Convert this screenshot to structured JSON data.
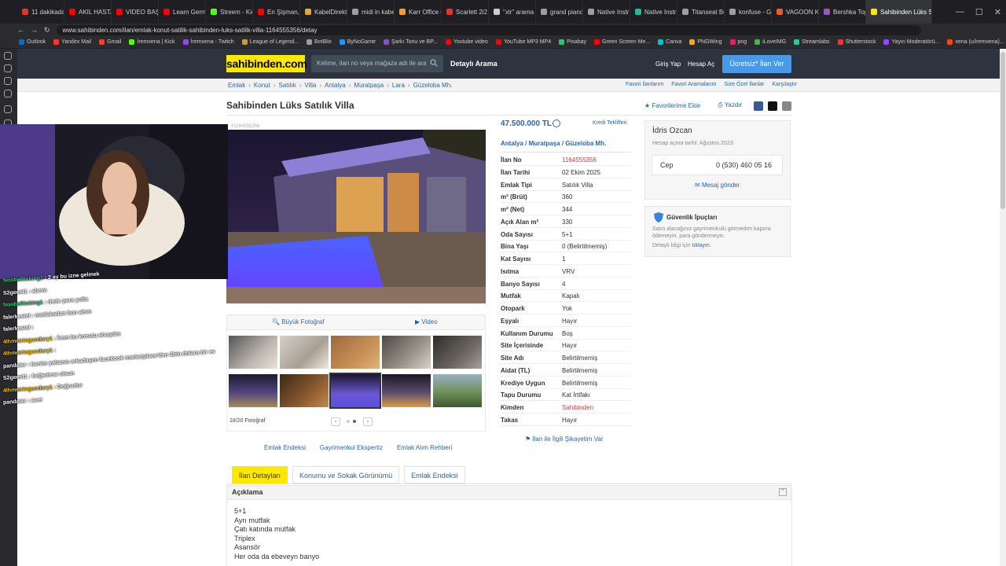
{
  "browser": {
    "tabs": [
      {
        "label": "11 dakikada",
        "color": "#e5322d"
      },
      {
        "label": "AKIL HASTA",
        "color": "#ff0000"
      },
      {
        "label": "VIDEO BAŞI",
        "color": "#ff0000"
      },
      {
        "label": "Learn Germ",
        "color": "#ff0000"
      },
      {
        "label": "Streem - Kic",
        "color": "#53fc18"
      },
      {
        "label": "En Şişman,",
        "color": "#ff0000"
      },
      {
        "label": "KabelDirekt",
        "color": "#e8a33c"
      },
      {
        "label": "midi in kabe",
        "color": "#9e9e9e"
      },
      {
        "label": "Karr Office C",
        "color": "#f0a030"
      },
      {
        "label": "Scarlett 2i2",
        "color": "#e5322d"
      },
      {
        "label": "\"xlr\" arama ",
        "color": "#cccccc"
      },
      {
        "label": "grand piano",
        "color": "#9e9e9e"
      },
      {
        "label": "Native Instru",
        "color": "#9e9e9e"
      },
      {
        "label": "Native Instru",
        "color": "#1abc9c"
      },
      {
        "label": "Titanseat Be",
        "color": "#9e9e9e"
      },
      {
        "label": "konfuse - G",
        "color": "#9e9e9e"
      },
      {
        "label": "VAGOON Ka",
        "color": "#e85a2a"
      },
      {
        "label": "Bershka Top",
        "color": "#9b59b6"
      },
      {
        "label": "Sahibinden Lüks Satılık",
        "color": "#ffe800"
      }
    ],
    "url": "www.sahibinden.com/ilan/emlak-konut-satilik-sahibinden-luks-satilik-villa-1164555356/detay",
    "bookmarks": [
      {
        "label": "Outlook",
        "color": "#0f6cbd"
      },
      {
        "label": "Yandex Mail",
        "color": "#ff3333"
      },
      {
        "label": "Gmail",
        "color": "#ea4335"
      },
      {
        "label": "İremxena | Kick",
        "color": "#53fc18"
      },
      {
        "label": "İremxena - Twitch",
        "color": "#9146ff"
      },
      {
        "label": "League of Legend...",
        "color": "#c89b3c"
      },
      {
        "label": "BotBlix",
        "color": "#9e9e9e"
      },
      {
        "label": "ByNoGame",
        "color": "#2196f3"
      },
      {
        "label": "Şarkı Tonu ve BP...",
        "color": "#7e57c2"
      },
      {
        "label": "Youtube video",
        "color": "#ff0000"
      },
      {
        "label": "YouTube MP3 MP4",
        "color": "#ff0000"
      },
      {
        "label": "Pixabay",
        "color": "#2ec66d"
      },
      {
        "label": "Green Screen Me...",
        "color": "#ff0000"
      },
      {
        "label": "Canva",
        "color": "#00c4cc"
      },
      {
        "label": "PNGWing",
        "color": "#f5a623"
      },
      {
        "label": "png",
        "color": "#e91e63"
      },
      {
        "label": "iLoveIMG",
        "color": "#4caf50"
      },
      {
        "label": "Streamlabs",
        "color": "#31c3a2"
      },
      {
        "label": "Shutterstock",
        "color": "#e53935"
      },
      {
        "label": "Yayın Moderatörü...",
        "color": "#9146ff"
      },
      {
        "label": "xena (u/iremxena)...",
        "color": "#ff4500"
      }
    ]
  },
  "header": {
    "logo": "sahibinden.com",
    "search_placeholder": "Kelime, ilan no veya mağaza adı ile ara",
    "advanced_search": "Detaylı Arama",
    "login": "Giriş Yap",
    "register": "Hesap Aç",
    "post_ad": "Ücretsiz* İlan Ver"
  },
  "breadcrumb": [
    "Emlak",
    "Konut",
    "Satılık",
    "Villa",
    "Antalya",
    "Muratpaşa",
    "Lara",
    "Güzeloba Mh."
  ],
  "right_links": [
    "Favori İlanlarım",
    "Favori Aramalarım",
    "Size Özel İlanlar",
    "Karşılaştır"
  ],
  "listing": {
    "title": "Sahibinden Lüks Satılık Villa",
    "add_favorite": "Favorilerime Ekle",
    "print": "Yazdır",
    "image_id": "#1164555356",
    "big_photo": "Büyük Fotoğraf",
    "video": "Video",
    "photo_counter": "18/20 Fotoğraf",
    "price": "47.500.000 TL",
    "credit_offers": "Kredi Teklifleri",
    "location": {
      "city": "Antalya",
      "district": "Muratpaşa",
      "neighborhood": "Güzeloba Mh."
    },
    "specs": [
      {
        "key": "İlan No",
        "value": "1164555356",
        "red": true
      },
      {
        "key": "İlan Tarihi",
        "value": "02 Ekim 2025"
      },
      {
        "key": "Emlak Tipi",
        "value": "Satılık Villa"
      },
      {
        "key": "m² (Brüt)",
        "value": "360"
      },
      {
        "key": "m² (Net)",
        "value": "344"
      },
      {
        "key": "Açık Alan m²",
        "value": "330"
      },
      {
        "key": "Oda Sayısı",
        "value": "5+1"
      },
      {
        "key": "Bina Yaşı",
        "value": "0 (Belirtilmemiş)"
      },
      {
        "key": "Kat Sayısı",
        "value": "1"
      },
      {
        "key": "Isıtma",
        "value": "VRV"
      },
      {
        "key": "Banyo Sayısı",
        "value": "4"
      },
      {
        "key": "Mutfak",
        "value": "Kapalı"
      },
      {
        "key": "Otopark",
        "value": "Yok"
      },
      {
        "key": "Eşyalı",
        "value": "Hayır"
      },
      {
        "key": "Kullanım Durumu",
        "value": "Boş"
      },
      {
        "key": "Site İçerisinde",
        "value": "Hayır"
      },
      {
        "key": "Site Adı",
        "value": "Belirtilmemiş"
      },
      {
        "key": "Aidat (TL)",
        "value": "Belirtilmemiş"
      },
      {
        "key": "Krediye Uygun",
        "value": "Belirtilmemiş"
      },
      {
        "key": "Tapu Durumu",
        "value": "Kat İrtifakı"
      },
      {
        "key": "Kimden",
        "value": "Sahibinden",
        "red": true
      },
      {
        "key": "Takas",
        "value": "Hayır"
      }
    ],
    "complaint": "İlan ile İlgili Şikayetim Var"
  },
  "seller": {
    "name": "İdris Ozcan",
    "since": "Hesap açma tarihi: Ağustos 2023",
    "phone_label": "Cep",
    "phone": "0 (530) 460 05 16",
    "message": "Mesaj gönder"
  },
  "security": {
    "title": "Güvenlik İpuçları",
    "text": "Satın alacağınız gayrimenkulü görmeden kapora ödemeyin, para göndermeyin.",
    "detail_prefix": "Detaylı bilgi için",
    "detail_link": "tıklayın."
  },
  "bottom_links": [
    "Emlak Endeksi",
    "Gayrimenkul Ekspertiz",
    "Emlak Alım Rehberi"
  ],
  "detail_tabs": [
    "İlan Detayları",
    "Konumu ve Sokak Görünümü",
    "Emlak Endeksi"
  ],
  "description": {
    "title": "Açıklama",
    "lines": [
      "5+1",
      "Ayrı mutfak",
      "Çatı katında mutfak",
      "Triplex",
      "Asansör",
      "Her oda da ebeveyn banyo"
    ]
  },
  "chat": [
    {
      "user": "NonbeRisking1",
      "msg": ": 2 ay bu izne gelmek",
      "color": "#2ecc71"
    },
    {
      "user": "S2geest1",
      "msg": ": alırım",
      "color": "#ffffff"
    },
    {
      "user": "NonbeRisking1",
      "msg": ": dede para yolla",
      "color": "#2ecc71"
    },
    {
      "user": "falerkestel",
      "msg": ": mutlakadan bun alsın",
      "color": "#ffffff"
    },
    {
      "user": "falerkestel",
      "msg": ":",
      "color": "#ffffff"
    },
    {
      "user": "4lhmetringundary1",
      "msg": ": İrem bu konutu alsaydın",
      "color": "#f1c40f"
    },
    {
      "user": "4lhmetringundary1",
      "msg": ":",
      "color": "#f1c40f"
    },
    {
      "user": "pandater",
      "msg": ": benim yabancı arkadaşım facebook marketplace'den 3bin dolara bir ev",
      "color": "#ffffff"
    },
    {
      "user": "S2geest1",
      "msg": ": beğenirse olsun",
      "color": "#ffffff"
    },
    {
      "user": "4lhmetringundary1",
      "msg": ": Doğrudur",
      "color": "#f1c40f"
    },
    {
      "user": "pandater",
      "msg": ": evet",
      "color": "#ffffff"
    }
  ]
}
